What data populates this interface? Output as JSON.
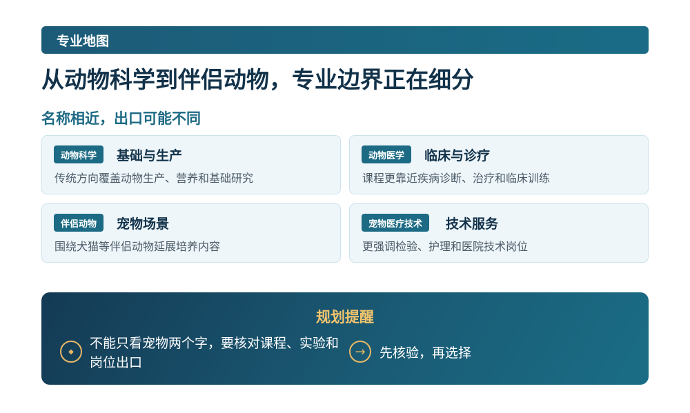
{
  "header": {
    "label": "专业地图"
  },
  "headline": "从动物科学到伴侣动物，专业边界正在细分",
  "subhead": "名称相近，出口可能不同",
  "cards": [
    {
      "tag": "动物科学",
      "title": "基础与生产",
      "desc": "传统方向覆盖动物生产、营养和基础研究"
    },
    {
      "tag": "动物医学",
      "title": "临床与诊疗",
      "desc": "课程更靠近疾病诊断、治疗和临床训练"
    },
    {
      "tag": "伴侣动物",
      "title": "宠物场景",
      "desc": "围绕犬猫等伴侣动物延展培养内容"
    },
    {
      "tag": "宠物医疗技术",
      "title": "技术服务",
      "desc": "更强调检验、护理和医院技术岗位"
    }
  ],
  "reminder": {
    "title": "规划提醒",
    "items": [
      {
        "icon": "diamond-icon",
        "glyph": "◆",
        "text": "不能只看宠物两个字，要核对课程、实验和岗位出口"
      },
      {
        "icon": "arrow-right-icon",
        "glyph": "→",
        "text": "先核验，再选择"
      }
    ]
  },
  "colors": {
    "primary": "#1c6a83",
    "headline": "#12324a",
    "accent_gold": "#f2c46d",
    "card_bg": "#eef6fa"
  }
}
